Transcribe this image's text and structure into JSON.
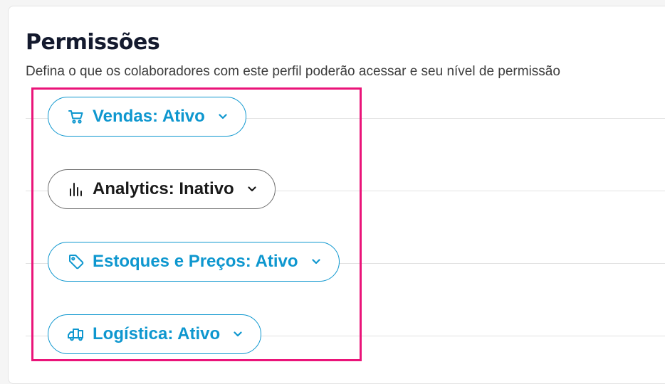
{
  "header": {
    "title": "Permissões",
    "subtitle": "Defina o que os colaboradores com este perfil poderão acessar e seu nível de permissão"
  },
  "modules": [
    {
      "name": "Vendas",
      "status": "Ativo",
      "label": "Vendas: Ativo",
      "icon": "cart-icon"
    },
    {
      "name": "Analytics",
      "status": "Inativo",
      "label": "Analytics: Inativo",
      "icon": "bar-chart-icon"
    },
    {
      "name": "Estoques e Preços",
      "status": "Ativo",
      "label": "Estoques e Preços: Ativo",
      "icon": "tag-icon"
    },
    {
      "name": "Logística",
      "status": "Ativo",
      "label": "Logística: Ativo",
      "icon": "truck-icon"
    }
  ],
  "colors": {
    "active": "#0e97cf",
    "inactive_text": "#1a1a1a",
    "inactive_border": "#6e6e6e",
    "highlight": "#ea1479",
    "title": "#141a2e"
  }
}
